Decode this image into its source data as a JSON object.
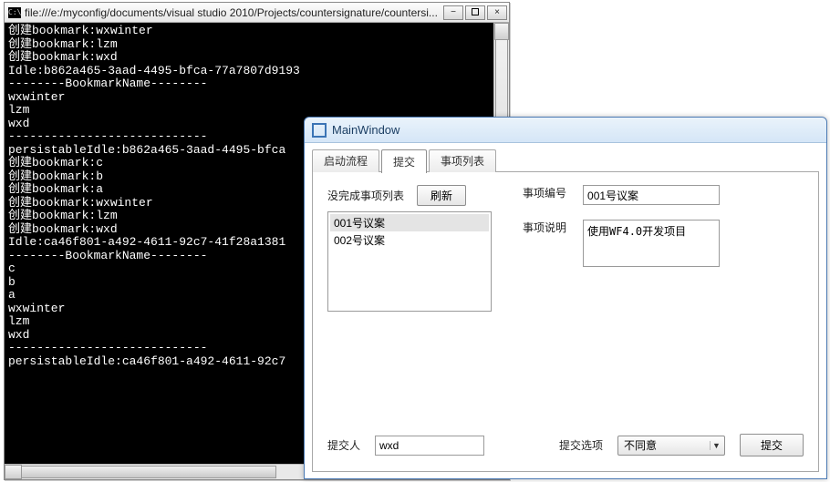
{
  "console": {
    "title": "file:///e:/myconfig/documents/visual studio 2010/Projects/countersignature/countersi...",
    "cmd_icon_text": "C:\\",
    "min_glyph": "−",
    "max_glyph": "",
    "close_glyph": "×",
    "lines": [
      "创建bookmark:wxwinter",
      "创建bookmark:lzm",
      "创建bookmark:wxd",
      "Idle:b862a465-3aad-4495-bfca-77a7807d9193",
      "--------BookmarkName--------",
      "wxwinter",
      "lzm",
      "wxd",
      "----------------------------",
      "persistableIdle:b862a465-3aad-4495-bfca",
      "创建bookmark:c",
      "创建bookmark:b",
      "创建bookmark:a",
      "创建bookmark:wxwinter",
      "创建bookmark:lzm",
      "创建bookmark:wxd",
      "Idle:ca46f801-a492-4611-92c7-41f28a1381",
      "--------BookmarkName--------",
      "c",
      "b",
      "a",
      "wxwinter",
      "lzm",
      "wxd",
      "----------------------------",
      "persistableIdle:ca46f801-a492-4611-92c7",
      "",
      ""
    ]
  },
  "wpf": {
    "title": "MainWindow",
    "tabs": [
      {
        "label": "启动流程",
        "active": false
      },
      {
        "label": "提交",
        "active": true
      },
      {
        "label": "事项列表",
        "active": false
      }
    ],
    "pane": {
      "listLabel": "没完成事项列表",
      "refresh": "刷新",
      "listItems": [
        "001号议案",
        "002号议案"
      ],
      "selectedIndex": 0,
      "fields": {
        "idLabel": "事项编号",
        "idValue": "001号议案",
        "descLabel": "事项说明",
        "descValue": "使用WF4.0开发项目"
      },
      "bottom": {
        "submitterLabel": "提交人",
        "submitterValue": "wxd",
        "optionLabel": "提交选项",
        "optionValue": "不同意",
        "submit": "提交"
      }
    }
  }
}
